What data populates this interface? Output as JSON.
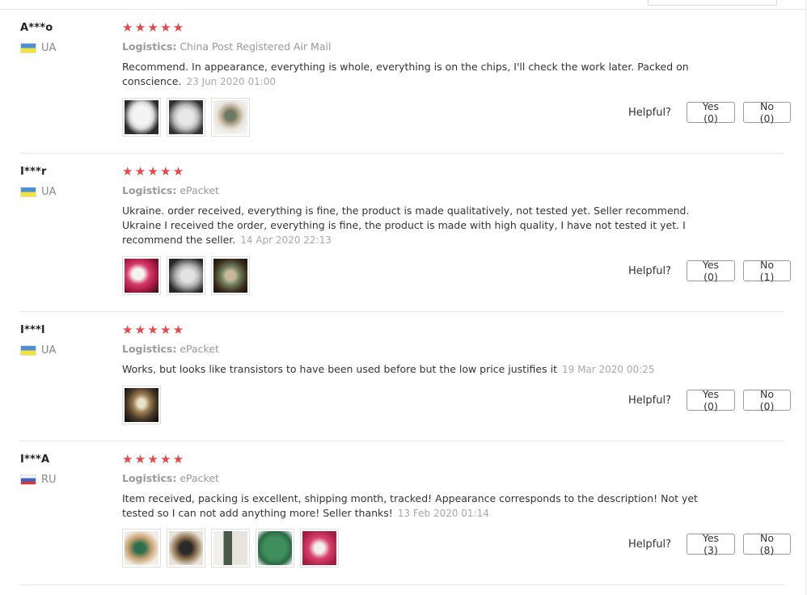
{
  "reviews": [
    {
      "user": "A***o",
      "country": "UA",
      "rating": 5,
      "logistics_label": "Logistics:",
      "logistics": "China Post Registered Air Mail",
      "text": "Recommend. In appearance, everything is whole, everything is on the chips, I'll check the work later. Packed on conscience.",
      "date": "23 Jun 2020 01:00",
      "photo_count": 3,
      "helpful_label": "Helpful?",
      "yes_label": "Yes (0)",
      "no_label": "No (0)"
    },
    {
      "user": "I***r",
      "country": "UA",
      "rating": 5,
      "logistics_label": "Logistics:",
      "logistics": "ePacket",
      "text": "Ukraine. order received, everything is fine, the product is made qualitatively, not tested yet. Seller recommend. Ukraine I received the order, everything is fine, the product is made with high quality, I have not tested it yet. I recommend the seller.",
      "date": "14 Apr 2020 22:13",
      "photo_count": 3,
      "helpful_label": "Helpful?",
      "yes_label": "Yes (0)",
      "no_label": "No (1)"
    },
    {
      "user": "I***l",
      "country": "UA",
      "rating": 5,
      "logistics_label": "Logistics:",
      "logistics": "ePacket",
      "text": "Works, but looks like transistors to have been used before but the low price justifies it",
      "date": "19 Mar 2020 00:25",
      "photo_count": 1,
      "helpful_label": "Helpful?",
      "yes_label": "Yes (0)",
      "no_label": "No (0)"
    },
    {
      "user": "I***A",
      "country": "RU",
      "rating": 5,
      "logistics_label": "Logistics:",
      "logistics": "ePacket",
      "text": "Item received, packing is excellent, shipping month, tracked! Appearance corresponds to the description! Not yet tested so I can not add anything more! Seller thanks!",
      "date": "13 Feb 2020 01:14",
      "photo_count": 5,
      "helpful_label": "Helpful?",
      "yes_label": "Yes (3)",
      "no_label": "No (8)"
    }
  ],
  "icons": {
    "star": "star-icon",
    "flag_ua": "flag-ua-icon",
    "flag_ru": "flag-ru-icon"
  },
  "colors": {
    "star": "#e94649",
    "muted_text": "#999999",
    "date_text": "#a8a8a8",
    "separator": "#e6e6e6"
  }
}
